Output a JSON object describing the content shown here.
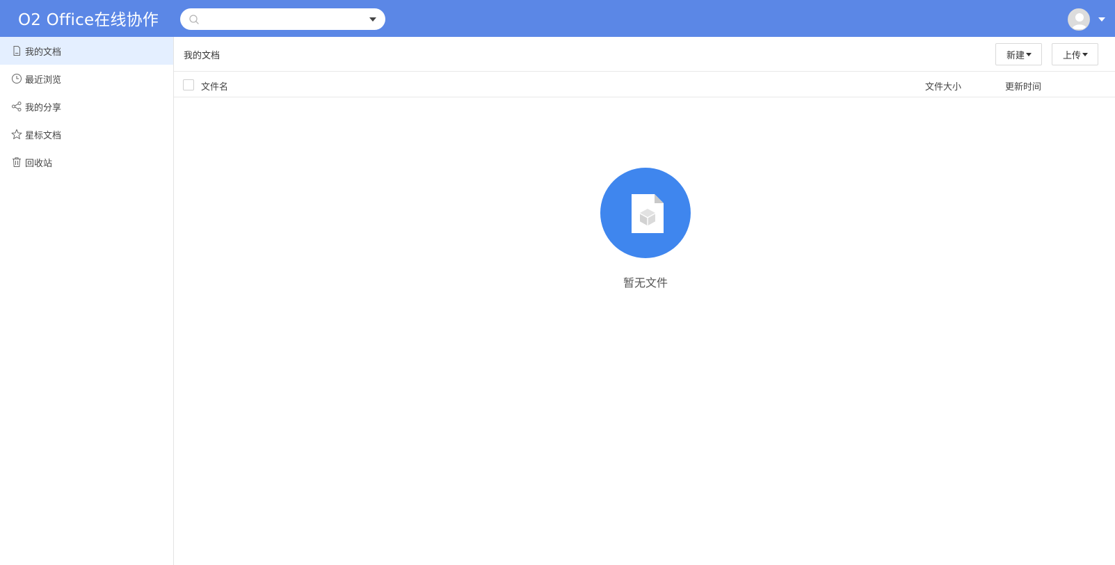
{
  "header": {
    "app_title": "O2 Office在线协作",
    "search": {
      "placeholder": "",
      "value": ""
    }
  },
  "sidebar": {
    "items": [
      {
        "label": "我的文档",
        "icon": "document-icon",
        "active": true
      },
      {
        "label": "最近浏览",
        "icon": "clock-icon",
        "active": false
      },
      {
        "label": "我的分享",
        "icon": "share-icon",
        "active": false
      },
      {
        "label": "星标文档",
        "icon": "star-icon",
        "active": false
      },
      {
        "label": "回收站",
        "icon": "trash-icon",
        "active": false
      }
    ]
  },
  "main": {
    "breadcrumb": "我的文档",
    "buttons": {
      "new_label": "新建",
      "upload_label": "上传"
    },
    "columns": {
      "name": "文件名",
      "size": "文件大小",
      "updated": "更新时间"
    },
    "empty_text": "暂无文件"
  },
  "colors": {
    "header_bg": "#5b87e6",
    "active_item_bg": "#e4efff",
    "empty_circle": "#3f86ee"
  }
}
